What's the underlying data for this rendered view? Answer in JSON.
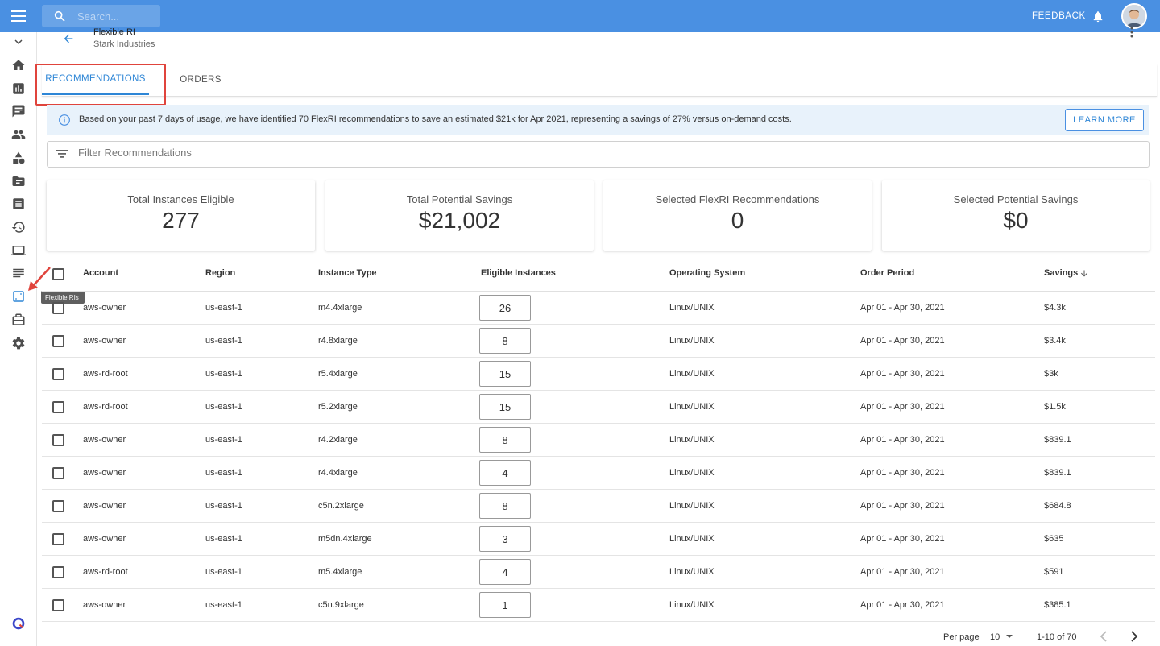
{
  "topbar": {
    "search_placeholder": "Search...",
    "feedback_label": "FEEDBACK"
  },
  "sidebar": {
    "tooltip": "Flexible RIs",
    "items": [
      "chevron-down",
      "home",
      "reports",
      "chat",
      "users",
      "shapes",
      "folder",
      "document",
      "history",
      "laptop",
      "list",
      "flexible-ris",
      "store",
      "settings"
    ]
  },
  "header": {
    "title": "Flexible RI",
    "subtitle": "Stark Industries"
  },
  "tabs": [
    {
      "label": "RECOMMENDATIONS",
      "active": true
    },
    {
      "label": "ORDERS",
      "active": false
    }
  ],
  "banner": {
    "text": "Based on your past 7 days of usage, we have identified 70 FlexRI recommendations to save an estimated $21k for Apr 2021, representing a savings of 27% versus on-demand costs.",
    "button": "LEARN MORE"
  },
  "filter": {
    "placeholder": "Filter Recommendations"
  },
  "stats": [
    {
      "label": "Total Instances Eligible",
      "value": "277"
    },
    {
      "label": "Total Potential Savings",
      "value": "$21,002"
    },
    {
      "label": "Selected FlexRI Recommendations",
      "value": "0"
    },
    {
      "label": "Selected Potential Savings",
      "value": "$0"
    }
  ],
  "table": {
    "columns": [
      "Account",
      "Region",
      "Instance Type",
      "Eligible Instances",
      "Operating System",
      "Order Period",
      "Savings"
    ],
    "rows": [
      {
        "account": "aws-owner",
        "region": "us-east-1",
        "instance_type": "m4.4xlarge",
        "eligible": "26",
        "os": "Linux/UNIX",
        "period": "Apr 01 - Apr 30, 2021",
        "savings": "$4.3k"
      },
      {
        "account": "aws-owner",
        "region": "us-east-1",
        "instance_type": "r4.8xlarge",
        "eligible": "8",
        "os": "Linux/UNIX",
        "period": "Apr 01 - Apr 30, 2021",
        "savings": "$3.4k"
      },
      {
        "account": "aws-rd-root",
        "region": "us-east-1",
        "instance_type": "r5.4xlarge",
        "eligible": "15",
        "os": "Linux/UNIX",
        "period": "Apr 01 - Apr 30, 2021",
        "savings": "$3k"
      },
      {
        "account": "aws-rd-root",
        "region": "us-east-1",
        "instance_type": "r5.2xlarge",
        "eligible": "15",
        "os": "Linux/UNIX",
        "period": "Apr 01 - Apr 30, 2021",
        "savings": "$1.5k"
      },
      {
        "account": "aws-owner",
        "region": "us-east-1",
        "instance_type": "r4.2xlarge",
        "eligible": "8",
        "os": "Linux/UNIX",
        "period": "Apr 01 - Apr 30, 2021",
        "savings": "$839.1"
      },
      {
        "account": "aws-owner",
        "region": "us-east-1",
        "instance_type": "r4.4xlarge",
        "eligible": "4",
        "os": "Linux/UNIX",
        "period": "Apr 01 - Apr 30, 2021",
        "savings": "$839.1"
      },
      {
        "account": "aws-owner",
        "region": "us-east-1",
        "instance_type": "c5n.2xlarge",
        "eligible": "8",
        "os": "Linux/UNIX",
        "period": "Apr 01 - Apr 30, 2021",
        "savings": "$684.8"
      },
      {
        "account": "aws-owner",
        "region": "us-east-1",
        "instance_type": "m5dn.4xlarge",
        "eligible": "3",
        "os": "Linux/UNIX",
        "period": "Apr 01 - Apr 30, 2021",
        "savings": "$635"
      },
      {
        "account": "aws-rd-root",
        "region": "us-east-1",
        "instance_type": "m5.4xlarge",
        "eligible": "4",
        "os": "Linux/UNIX",
        "period": "Apr 01 - Apr 30, 2021",
        "savings": "$591"
      },
      {
        "account": "aws-owner",
        "region": "us-east-1",
        "instance_type": "c5n.9xlarge",
        "eligible": "1",
        "os": "Linux/UNIX",
        "period": "Apr 01 - Apr 30, 2021",
        "savings": "$385.1"
      }
    ]
  },
  "pagination": {
    "per_page_label": "Per page",
    "per_page_value": "10",
    "range": "1-10 of 70"
  },
  "colors": {
    "topbar": "#4a90e2",
    "accent": "#2e86d6",
    "banner_bg": "#e8f2fb",
    "annotation_red": "#e0443c"
  }
}
